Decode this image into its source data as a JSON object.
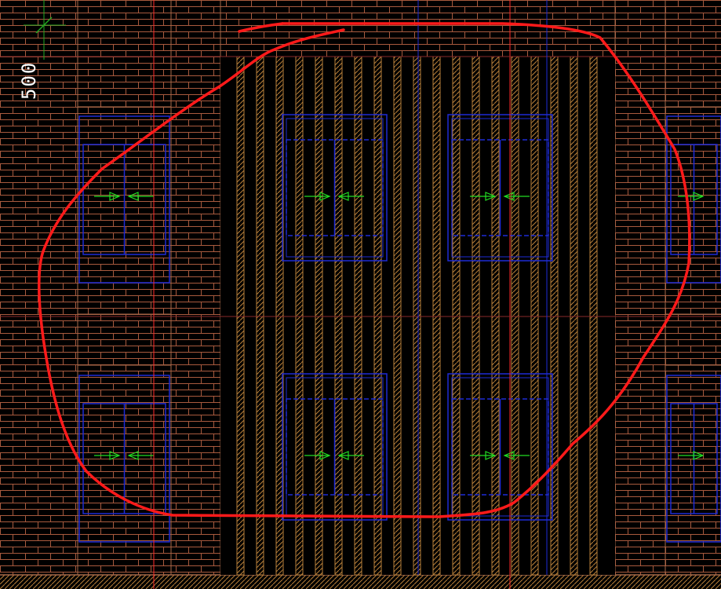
{
  "drawing": {
    "dimension_label": "500",
    "colors": {
      "background": "#000000",
      "brick": "#a85a3e",
      "structure": "#a86a4a",
      "window": "#1e2bd6",
      "arrow": "#22dd22",
      "axis": "#ff2a2a",
      "markup": "#ff1a1a",
      "hatch": "#b8803a",
      "text": "#ffffff"
    },
    "layers": [
      "brick-wall",
      "louver-screen",
      "window-frames",
      "opening-arrows",
      "axis-lines",
      "revision-markup"
    ]
  }
}
